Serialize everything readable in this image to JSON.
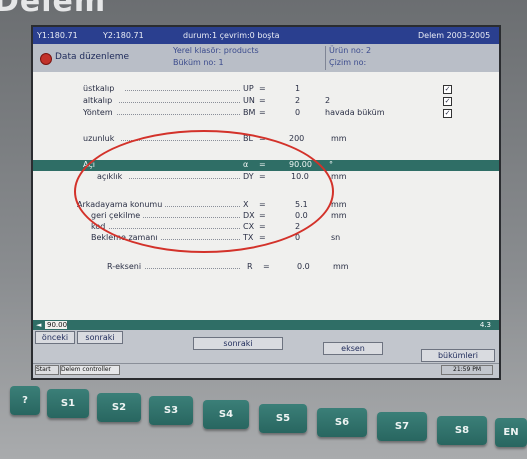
{
  "brand": "Delem",
  "title_bar": {
    "y1": "Y1:180.71",
    "y2": "Y2:180.71",
    "status": "durum:1  çevrim:0  boşta",
    "copyright": "Delem 2003-2005"
  },
  "header": {
    "mode": "Data düzenleme",
    "line1": "Yerel klasör: products",
    "line2": "Büküm no: 1",
    "product": "Ürün no: 2",
    "drawing": "Çizim no:"
  },
  "params": [
    {
      "label": "üstkalıp",
      "code": "UP",
      "value": "1",
      "unit": "",
      "checkbox": true
    },
    {
      "label": "altkalıp",
      "code": "UN",
      "value": "2",
      "unit": "2",
      "checkbox": true
    },
    {
      "label": "Yöntem",
      "code": "BM",
      "value": "0",
      "unit": "havada büküm",
      "checkbox": true
    },
    {
      "label": "uzunluk",
      "code": "BL",
      "value": "200",
      "unit": "mm",
      "checkbox": false
    }
  ],
  "angle_row": {
    "label": "Açı",
    "code": "α",
    "value": "90.00",
    "unit": "°"
  },
  "opening_row": {
    "label": "açıklık",
    "code": "DY",
    "value": "10.0",
    "unit": "mm"
  },
  "backgauge": [
    {
      "label": "Arkadayama konumu",
      "code": "X",
      "value": "5.1",
      "unit": "mm"
    },
    {
      "label": "geri çekilme",
      "code": "DX",
      "value": "0.0",
      "unit": "mm"
    },
    {
      "label": "kod",
      "code": "CX",
      "value": "2",
      "unit": ""
    },
    {
      "label": "Bekleme zamanı",
      "code": "TX",
      "value": "0",
      "unit": "sn"
    }
  ],
  "r_axis": {
    "label": "R-ekseni",
    "code": "R",
    "value": "0.0",
    "unit": "mm"
  },
  "value_bar": {
    "input": "90.00",
    "right_value": "4.3"
  },
  "softkeys": {
    "prev": "önceki",
    "next1": "sonraki",
    "next2": "sonraki",
    "axis": "eksen",
    "bends": "bükümleri"
  },
  "taskbar": {
    "start": "Start",
    "task": "Delem controller",
    "clock": "21:59 PM"
  },
  "function_keys": [
    "?",
    "S1",
    "S2",
    "S3",
    "S4",
    "S5",
    "S6",
    "S7",
    "S8",
    "EN"
  ],
  "colors": {
    "screen_bg": "#f0f0ee",
    "title_bar": "#2a3f8f",
    "highlight": "#2f6e66",
    "function_key": "#2f6e66",
    "annotation_red": "#d3322a"
  }
}
